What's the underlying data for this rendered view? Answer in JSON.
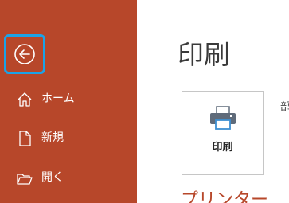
{
  "sidebar": {
    "back_icon": "back-arrow-icon",
    "accent_color": "#b7472a",
    "focus_color": "#1aa3e8",
    "items": [
      {
        "label": "ホーム",
        "icon": "home-icon"
      },
      {
        "label": "新規",
        "icon": "new-document-icon"
      },
      {
        "label": "開く",
        "icon": "open-folder-icon"
      }
    ]
  },
  "main": {
    "title": "印刷",
    "print_button": {
      "label": "印刷",
      "icon": "printer-icon"
    },
    "side_text": "部",
    "section_heading": "プリンター"
  }
}
